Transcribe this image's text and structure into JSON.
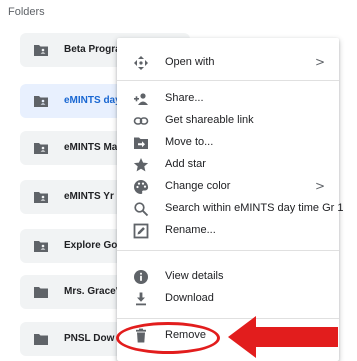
{
  "section": {
    "title": "Folders"
  },
  "folders": [
    {
      "name": "Beta Prograi"
    },
    {
      "name": "eMINTS day"
    },
    {
      "name": "eMINTS Mal"
    },
    {
      "name": "eMINTS Yr 1"
    },
    {
      "name": "Explore Goo"
    },
    {
      "name": "Mrs. Grace's"
    },
    {
      "name": "PNSL Dow"
    }
  ],
  "menu": {
    "items": [
      {
        "label": "Open with",
        "icon": "open-with-icon",
        "submenu": ">"
      },
      {
        "label": "Share...",
        "icon": "share-person-add-icon"
      },
      {
        "label": "Get shareable link",
        "icon": "link-icon"
      },
      {
        "label": "Move to...",
        "icon": "move-to-folder-icon"
      },
      {
        "label": "Add star",
        "icon": "star-icon"
      },
      {
        "label": "Change color",
        "icon": "palette-icon",
        "submenu": ">"
      },
      {
        "label": "Search within eMINTS day time Gr 1",
        "icon": "search-icon"
      },
      {
        "label": "Rename...",
        "icon": "rename-pencil-icon"
      },
      {
        "label": "View details",
        "icon": "info-icon"
      },
      {
        "label": "Download",
        "icon": "download-icon"
      },
      {
        "label": "Remove",
        "icon": "trash-icon"
      }
    ]
  },
  "colors": {
    "annotation_red": "#e21d1d",
    "selected_text": "#1967d2",
    "selected_bg": "#e8f0fe",
    "tile_bg": "#f1f3f4"
  }
}
